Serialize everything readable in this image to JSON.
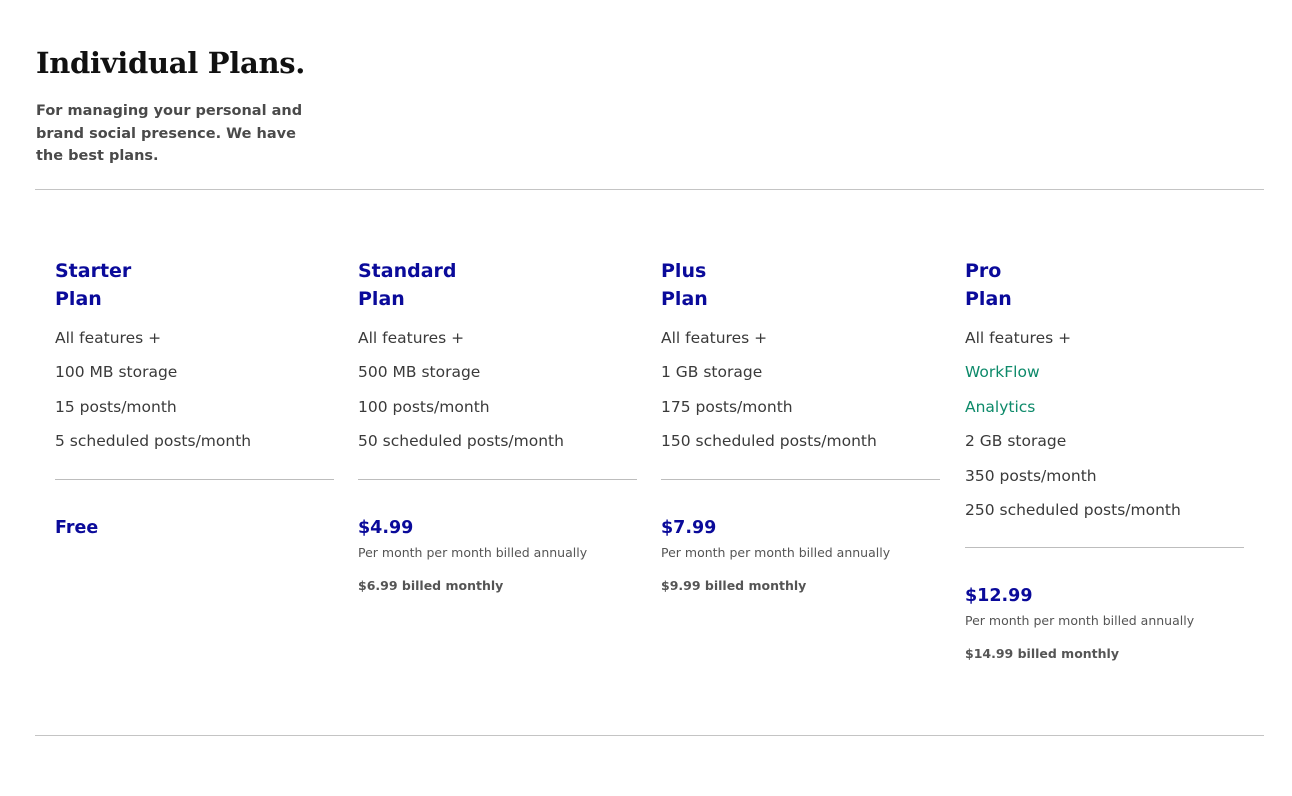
{
  "header": {
    "title": "Individual Plans.",
    "subtitle": "For managing your personal and brand social presence. We have the best plans."
  },
  "colors": {
    "plan_accent": "#0a0a9a",
    "highlight_feature": "#0d8a6a",
    "body_text": "#3a3a3a"
  },
  "plans": [
    {
      "name_line1": "Starter",
      "name_line2": "Plan",
      "features": [
        "All features +",
        "100 MB storage",
        "15 posts/month",
        "5 scheduled posts/month"
      ],
      "price": "Free"
    },
    {
      "name_line1": "Standard",
      "name_line2": "Plan",
      "features": [
        "All features +",
        "500 MB storage",
        "100 posts/month",
        "50 scheduled posts/month"
      ],
      "price": "$4.99",
      "annual_note": "Per month per month billed annually",
      "monthly_note": "$6.99 billed monthly"
    },
    {
      "name_line1": "Plus",
      "name_line2": "Plan",
      "features": [
        "All features +",
        "1 GB storage",
        "175 posts/month",
        "150 scheduled posts/month"
      ],
      "price": "$7.99",
      "annual_note": "Per month per month billed annually",
      "monthly_note": "$9.99 billed monthly"
    },
    {
      "name_line1": "Pro",
      "name_line2": "Plan",
      "features": [
        "All features +",
        "WorkFlow",
        "Analytics",
        "2 GB storage",
        "350 posts/month",
        "250 scheduled posts/month"
      ],
      "price": "$12.99",
      "annual_note": "Per month per month billed annually",
      "monthly_note": "$14.99 billed monthly"
    }
  ]
}
